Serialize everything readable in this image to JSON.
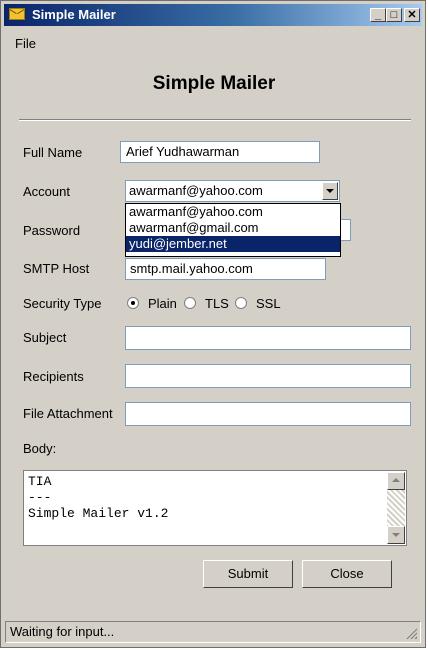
{
  "window": {
    "title": "Simple Mailer",
    "controls": {
      "minimize": "_",
      "maximize": "□",
      "close": "✕"
    }
  },
  "menu": {
    "file": "File"
  },
  "heading": "Simple Mailer",
  "form": {
    "full_name_label": "Full Name",
    "full_name_value": "Arief Yudhawarman",
    "account_label": "Account",
    "account_value": "awarmanf@yahoo.com",
    "account_options": [
      "awarmanf@yahoo.com",
      "awarmanf@gmail.com",
      "yudi@jember.net"
    ],
    "account_highlighted": "yudi@jember.net",
    "password_label": "Password",
    "smtp_label": "SMTP Host",
    "smtp_value": "smtp.mail.yahoo.com",
    "security_label": "Security Type",
    "security_options": [
      "Plain",
      "TLS",
      "SSL"
    ],
    "security_selected": "Plain",
    "subject_label": "Subject",
    "recipients_label": "Recipients",
    "attachment_label": "File Attachment",
    "body_label": "Body:",
    "body_lines": [
      "TIA",
      "---",
      "Simple Mailer v1.2"
    ]
  },
  "buttons": {
    "submit": "Submit",
    "close": "Close"
  },
  "status": "Waiting for input...",
  "colors": {
    "titlebar_start": "#0a246a",
    "titlebar_end": "#a6caf0",
    "window_bg": "#d4d0c8",
    "selection": "#0a246a"
  }
}
